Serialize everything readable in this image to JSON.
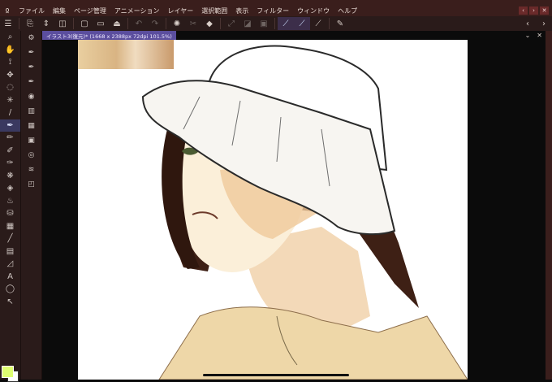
{
  "menubar": {
    "items": [
      "ファイル",
      "編集",
      "ページ管理",
      "アニメーション",
      "レイヤー",
      "選択範囲",
      "表示",
      "フィルター",
      "ウィンドウ",
      "ヘルプ"
    ]
  },
  "document_tab": {
    "label": "イラスト3(復元)* (1668 x 2388px 72dpi 101.5%)"
  },
  "colors": {
    "main_color": "#dfff72",
    "sub_color": "#ffffff",
    "ui_bg": "#2a1b1a",
    "accent": "#5b4e9e"
  },
  "icons": {
    "app": "app-logo-icon",
    "menu": "hamburger-icon",
    "undo": "undo-icon",
    "redo": "redo-icon",
    "window_controls": [
      "chevron-left-icon",
      "chevron-right-icon",
      "close-icon"
    ]
  }
}
